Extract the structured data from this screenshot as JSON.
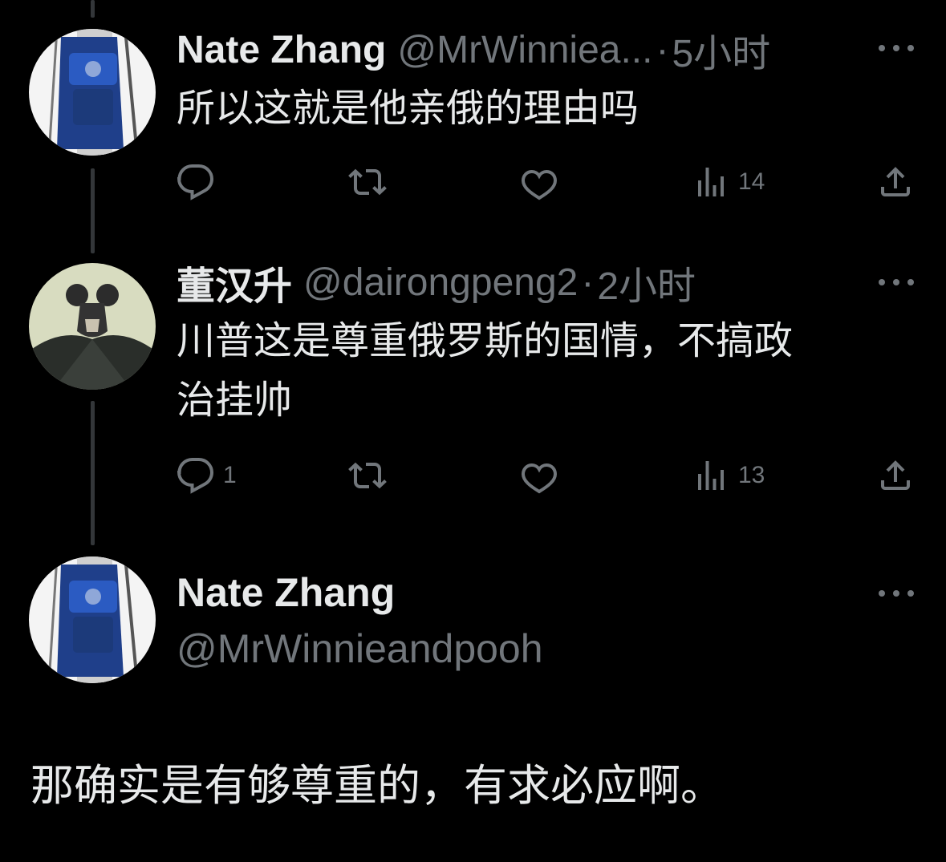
{
  "colors": {
    "background": "#000000",
    "primary_text": "#e7e9ea",
    "secondary_text": "#71767b",
    "thread_line": "#333639"
  },
  "replies": [
    {
      "author": {
        "name": "Nate Zhang",
        "handle": "@MrWinniea...",
        "avatar": "stroller-avatar-icon"
      },
      "separator": "·",
      "time": "5小时",
      "text": "所以这就是他亲俄的理由吗",
      "actions": {
        "reply_count": "",
        "retweet_count": "",
        "like_count": "",
        "views_count": "14"
      }
    },
    {
      "author": {
        "name": "董汉升",
        "handle": "@dairongpeng2",
        "avatar": "batman-mouse-avatar-icon"
      },
      "separator": "·",
      "time": "2小时",
      "text_line1": "川普这是尊重俄罗斯的国情，不搞政",
      "text_line2": "治挂帅",
      "actions": {
        "reply_count": "1",
        "retweet_count": "",
        "like_count": "",
        "views_count": "13"
      }
    }
  ],
  "main_tweet": {
    "author": {
      "name": "Nate Zhang",
      "handle": "@MrWinnieandpooh",
      "avatar": "stroller-avatar-icon"
    },
    "text": "那确实是有够尊重的，有求必应啊。"
  },
  "icons": {
    "reply": "reply-icon",
    "retweet": "retweet-icon",
    "like": "heart-icon",
    "views": "views-icon",
    "share": "share-icon",
    "more": "more-options-icon"
  }
}
